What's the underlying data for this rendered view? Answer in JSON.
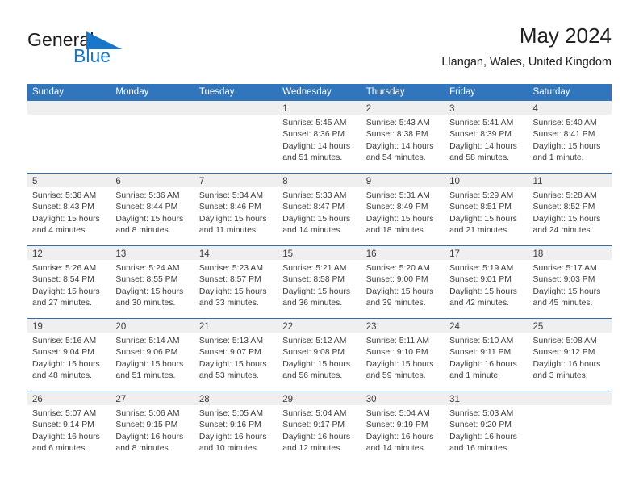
{
  "brand": {
    "name_primary": "General",
    "name_secondary": "Blue",
    "triangle_icon": "blue-triangle-icon",
    "primary_color": "#1a1a1a",
    "accent_color": "#1877c9"
  },
  "header": {
    "title": "May 2024",
    "location": "Llangan, Wales, United Kingdom"
  },
  "theme": {
    "weekday_header_bg": "#3176bc",
    "weekday_header_text": "#ffffff",
    "daynum_band_bg": "#efefef",
    "row_divider": "#2f6fb0",
    "body_text": "#3d3d3d"
  },
  "weekdays": [
    "Sunday",
    "Monday",
    "Tuesday",
    "Wednesday",
    "Thursday",
    "Friday",
    "Saturday"
  ],
  "weeks": [
    [
      {
        "day": "",
        "lines": []
      },
      {
        "day": "",
        "lines": []
      },
      {
        "day": "",
        "lines": []
      },
      {
        "day": "1",
        "lines": [
          "Sunrise: 5:45 AM",
          "Sunset: 8:36 PM",
          "Daylight: 14 hours",
          "and 51 minutes."
        ]
      },
      {
        "day": "2",
        "lines": [
          "Sunrise: 5:43 AM",
          "Sunset: 8:38 PM",
          "Daylight: 14 hours",
          "and 54 minutes."
        ]
      },
      {
        "day": "3",
        "lines": [
          "Sunrise: 5:41 AM",
          "Sunset: 8:39 PM",
          "Daylight: 14 hours",
          "and 58 minutes."
        ]
      },
      {
        "day": "4",
        "lines": [
          "Sunrise: 5:40 AM",
          "Sunset: 8:41 PM",
          "Daylight: 15 hours",
          "and 1 minute."
        ]
      }
    ],
    [
      {
        "day": "5",
        "lines": [
          "Sunrise: 5:38 AM",
          "Sunset: 8:43 PM",
          "Daylight: 15 hours",
          "and 4 minutes."
        ]
      },
      {
        "day": "6",
        "lines": [
          "Sunrise: 5:36 AM",
          "Sunset: 8:44 PM",
          "Daylight: 15 hours",
          "and 8 minutes."
        ]
      },
      {
        "day": "7",
        "lines": [
          "Sunrise: 5:34 AM",
          "Sunset: 8:46 PM",
          "Daylight: 15 hours",
          "and 11 minutes."
        ]
      },
      {
        "day": "8",
        "lines": [
          "Sunrise: 5:33 AM",
          "Sunset: 8:47 PM",
          "Daylight: 15 hours",
          "and 14 minutes."
        ]
      },
      {
        "day": "9",
        "lines": [
          "Sunrise: 5:31 AM",
          "Sunset: 8:49 PM",
          "Daylight: 15 hours",
          "and 18 minutes."
        ]
      },
      {
        "day": "10",
        "lines": [
          "Sunrise: 5:29 AM",
          "Sunset: 8:51 PM",
          "Daylight: 15 hours",
          "and 21 minutes."
        ]
      },
      {
        "day": "11",
        "lines": [
          "Sunrise: 5:28 AM",
          "Sunset: 8:52 PM",
          "Daylight: 15 hours",
          "and 24 minutes."
        ]
      }
    ],
    [
      {
        "day": "12",
        "lines": [
          "Sunrise: 5:26 AM",
          "Sunset: 8:54 PM",
          "Daylight: 15 hours",
          "and 27 minutes."
        ]
      },
      {
        "day": "13",
        "lines": [
          "Sunrise: 5:24 AM",
          "Sunset: 8:55 PM",
          "Daylight: 15 hours",
          "and 30 minutes."
        ]
      },
      {
        "day": "14",
        "lines": [
          "Sunrise: 5:23 AM",
          "Sunset: 8:57 PM",
          "Daylight: 15 hours",
          "and 33 minutes."
        ]
      },
      {
        "day": "15",
        "lines": [
          "Sunrise: 5:21 AM",
          "Sunset: 8:58 PM",
          "Daylight: 15 hours",
          "and 36 minutes."
        ]
      },
      {
        "day": "16",
        "lines": [
          "Sunrise: 5:20 AM",
          "Sunset: 9:00 PM",
          "Daylight: 15 hours",
          "and 39 minutes."
        ]
      },
      {
        "day": "17",
        "lines": [
          "Sunrise: 5:19 AM",
          "Sunset: 9:01 PM",
          "Daylight: 15 hours",
          "and 42 minutes."
        ]
      },
      {
        "day": "18",
        "lines": [
          "Sunrise: 5:17 AM",
          "Sunset: 9:03 PM",
          "Daylight: 15 hours",
          "and 45 minutes."
        ]
      }
    ],
    [
      {
        "day": "19",
        "lines": [
          "Sunrise: 5:16 AM",
          "Sunset: 9:04 PM",
          "Daylight: 15 hours",
          "and 48 minutes."
        ]
      },
      {
        "day": "20",
        "lines": [
          "Sunrise: 5:14 AM",
          "Sunset: 9:06 PM",
          "Daylight: 15 hours",
          "and 51 minutes."
        ]
      },
      {
        "day": "21",
        "lines": [
          "Sunrise: 5:13 AM",
          "Sunset: 9:07 PM",
          "Daylight: 15 hours",
          "and 53 minutes."
        ]
      },
      {
        "day": "22",
        "lines": [
          "Sunrise: 5:12 AM",
          "Sunset: 9:08 PM",
          "Daylight: 15 hours",
          "and 56 minutes."
        ]
      },
      {
        "day": "23",
        "lines": [
          "Sunrise: 5:11 AM",
          "Sunset: 9:10 PM",
          "Daylight: 15 hours",
          "and 59 minutes."
        ]
      },
      {
        "day": "24",
        "lines": [
          "Sunrise: 5:10 AM",
          "Sunset: 9:11 PM",
          "Daylight: 16 hours",
          "and 1 minute."
        ]
      },
      {
        "day": "25",
        "lines": [
          "Sunrise: 5:08 AM",
          "Sunset: 9:12 PM",
          "Daylight: 16 hours",
          "and 3 minutes."
        ]
      }
    ],
    [
      {
        "day": "26",
        "lines": [
          "Sunrise: 5:07 AM",
          "Sunset: 9:14 PM",
          "Daylight: 16 hours",
          "and 6 minutes."
        ]
      },
      {
        "day": "27",
        "lines": [
          "Sunrise: 5:06 AM",
          "Sunset: 9:15 PM",
          "Daylight: 16 hours",
          "and 8 minutes."
        ]
      },
      {
        "day": "28",
        "lines": [
          "Sunrise: 5:05 AM",
          "Sunset: 9:16 PM",
          "Daylight: 16 hours",
          "and 10 minutes."
        ]
      },
      {
        "day": "29",
        "lines": [
          "Sunrise: 5:04 AM",
          "Sunset: 9:17 PM",
          "Daylight: 16 hours",
          "and 12 minutes."
        ]
      },
      {
        "day": "30",
        "lines": [
          "Sunrise: 5:04 AM",
          "Sunset: 9:19 PM",
          "Daylight: 16 hours",
          "and 14 minutes."
        ]
      },
      {
        "day": "31",
        "lines": [
          "Sunrise: 5:03 AM",
          "Sunset: 9:20 PM",
          "Daylight: 16 hours",
          "and 16 minutes."
        ]
      },
      {
        "day": "",
        "lines": []
      }
    ]
  ]
}
